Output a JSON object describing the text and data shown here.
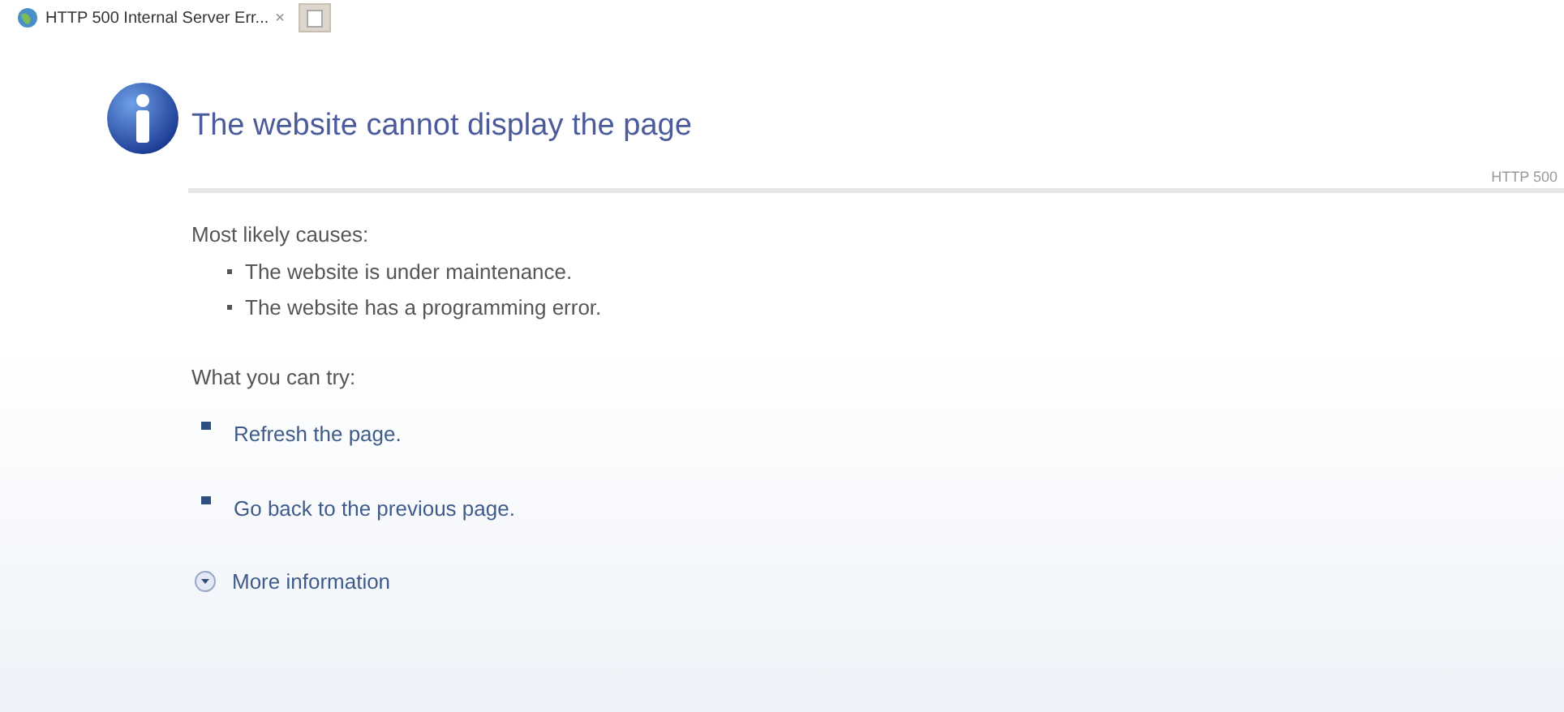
{
  "tab": {
    "title": "HTTP 500 Internal Server Err...",
    "close": "×"
  },
  "heading": "The website cannot display the page",
  "error_code": "HTTP 500",
  "causes": {
    "title": "Most likely causes:",
    "items": [
      "The website is under maintenance.",
      "The website has a programming error."
    ]
  },
  "try": {
    "title": "What you can try:",
    "actions": [
      "Refresh the page.",
      "Go back to the previous page."
    ]
  },
  "more_information": "More information"
}
